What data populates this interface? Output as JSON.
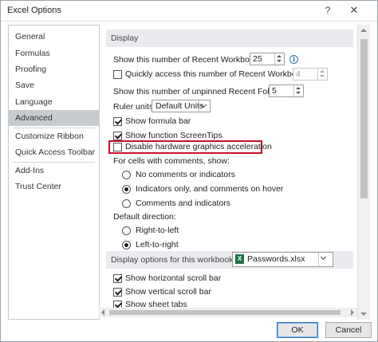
{
  "window": {
    "title": "Excel Options",
    "help_glyph": "?",
    "close_glyph": "✕"
  },
  "nav": {
    "items": [
      {
        "label": "General"
      },
      {
        "label": "Formulas"
      },
      {
        "label": "Proofing"
      },
      {
        "label": "Save"
      },
      {
        "label": "Language"
      },
      {
        "label": "Advanced"
      },
      {
        "label": "Customize Ribbon"
      },
      {
        "label": "Quick Access Toolbar"
      },
      {
        "label": "Add-Ins"
      },
      {
        "label": "Trust Center"
      }
    ],
    "selected": "Advanced"
  },
  "display": {
    "header": "Display",
    "recent_workbooks_label": "Show this number of Recent Workbooks:",
    "recent_workbooks_value": "25",
    "quick_access_label": "Quickly access this number of Recent Workbooks:",
    "quick_access_value": "4",
    "quick_access_checked": false,
    "unpinned_folders_label": "Show this number of unpinned Recent Folders:",
    "unpinned_folders_value": "5",
    "ruler_units_label": "Ruler units",
    "ruler_units_value": "Default Units",
    "show_formula_bar_label": "Show formula bar",
    "show_formula_bar_checked": true,
    "show_screentips_label": "Show function ScreenTips",
    "show_screentips_checked": true,
    "disable_hw_accel_label": "Disable hardware graphics acceleration",
    "disable_hw_accel_checked": false,
    "comments_group_label": "For cells with comments, show:",
    "comments_options": [
      {
        "label": "No comments or indicators",
        "selected": false
      },
      {
        "label": "Indicators only, and comments on hover",
        "selected": true
      },
      {
        "label": "Comments and indicators",
        "selected": false
      }
    ],
    "direction_group_label": "Default direction:",
    "direction_options": [
      {
        "label": "Right-to-left",
        "selected": false
      },
      {
        "label": "Left-to-right",
        "selected": true
      }
    ]
  },
  "workbook_display": {
    "header": "Display options for this workbook:",
    "workbook_value": "Passwords.xlsx",
    "workbook_icon_letter": "X",
    "horizontal_scroll_label": "Show horizontal scroll bar",
    "horizontal_scroll_checked": true,
    "vertical_scroll_label": "Show vertical scroll bar",
    "vertical_scroll_checked": true,
    "sheet_tabs_label": "Show sheet tabs",
    "sheet_tabs_checked": true
  },
  "footer": {
    "ok_label": "OK",
    "cancel_label": "Cancel"
  },
  "colors": {
    "highlight": "#c8102e",
    "selected_nav": "#c8ccd1",
    "excel_green": "#1e7145"
  }
}
